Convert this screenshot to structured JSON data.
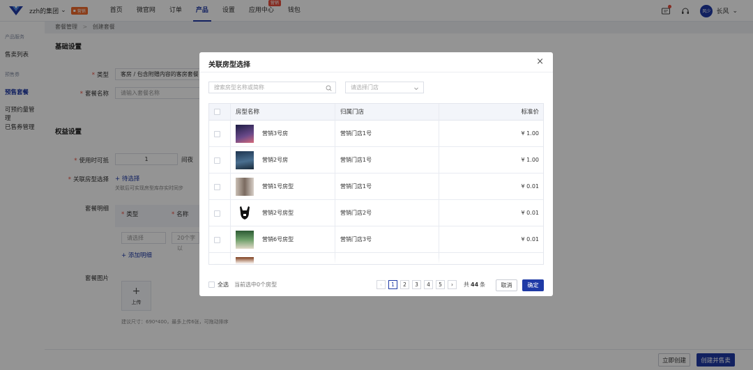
{
  "topnav": {
    "org": "zzh的集团",
    "org_badge": "营销",
    "items": [
      {
        "label": "首页"
      },
      {
        "label": "微官网"
      },
      {
        "label": "订单"
      },
      {
        "label": "产品",
        "active": true
      },
      {
        "label": "设置"
      },
      {
        "label": "应用中心",
        "tag": "营销"
      },
      {
        "label": "钱包"
      }
    ],
    "avatar_text": "风少",
    "user": "长风"
  },
  "sidebar": {
    "group1": "产品服务",
    "item1": "售卖列表",
    "group2": "预售券",
    "item2": "预售套餐",
    "item3": "可预约量管理",
    "item4": "已售券管理"
  },
  "main": {
    "breadcrumb_parent": "套餐管理",
    "breadcrumb_sep": ">",
    "breadcrumb_current": "创建套餐",
    "basic_title": "基础设置",
    "type_label": "类型",
    "type_value": "客房 / 包含附赠内容的客房套餐",
    "name_label": "套餐名称",
    "name_placeholder": "请输入套餐名称",
    "rights_title": "权益设置",
    "usage_label": "使用时可抵",
    "usage_value": "1",
    "usage_unit": "间夜",
    "room_label": "关联房型选择",
    "room_link": "+ 待选择",
    "room_hint": "关联后可实现房型库存实时同步",
    "detail_label": "套餐明细",
    "detail_col_type": "类型",
    "detail_col_name": "名称",
    "detail_select": "请选择",
    "detail_name_ph": "20个字以",
    "add_detail": "+ 添加明细",
    "image_label": "套餐图片",
    "upload": "上传",
    "image_hint": "建议尺寸：690*400，最多上传6张，可拖动排序",
    "btn_create_now": "立即创建",
    "btn_create_sell": "创建并售卖"
  },
  "modal": {
    "title": "关联房型选择",
    "close": "×",
    "search_placeholder": "搜索房型名称或简称",
    "store_placeholder": "请选择门店",
    "columns": {
      "name": "房型名称",
      "store": "归属门店",
      "price": "标准价"
    },
    "rows": [
      {
        "name": "营销3号房",
        "store": "营销门店1号",
        "price": "¥ 1.00",
        "thumb": "#3b3a6e"
      },
      {
        "name": "营销2号房",
        "store": "营销门店1号",
        "price": "¥ 1.00",
        "thumb": "#2a4a6a"
      },
      {
        "name": "营销1号房型",
        "store": "营销门店1号",
        "price": "¥ 0.01",
        "thumb": "#8a7a70"
      },
      {
        "name": "营销2号房型",
        "store": "营销门店2号",
        "price": "¥ 0.01",
        "thumb": "#ffffff"
      },
      {
        "name": "营销6号房型",
        "store": "营销门店3号",
        "price": "¥ 0.01",
        "thumb": "#3f6e47"
      }
    ],
    "select_all": "全选",
    "selected_hint": "当前选中0个房型",
    "pages": [
      "1",
      "2",
      "3",
      "4",
      "5"
    ],
    "total_prefix": "共",
    "total_count": "44",
    "total_suffix": "条",
    "cancel": "取消",
    "confirm": "确定"
  }
}
